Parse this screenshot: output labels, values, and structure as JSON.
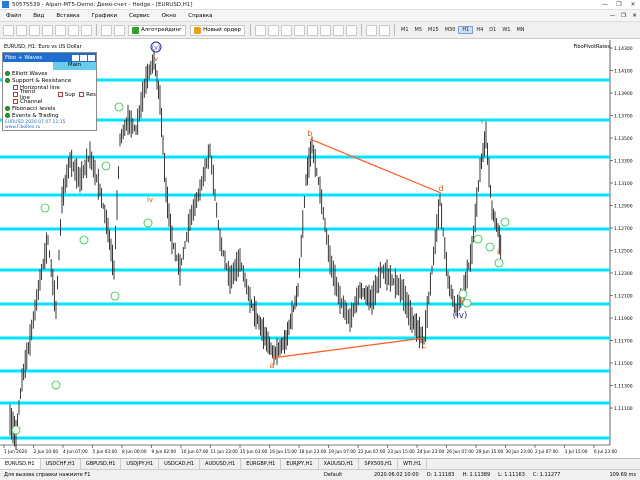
{
  "window": {
    "title": "50575539 - Alpari-MT5-Demo: Демо-счет - Hedge - [EURUSD,H1]",
    "controls": [
      "—",
      "❐",
      "✕"
    ]
  },
  "menu": {
    "items": [
      "Файл",
      "Вид",
      "Вставка",
      "Графики",
      "Сервис",
      "Окно",
      "Справка"
    ]
  },
  "toolbar": {
    "algo_label": "Алготрейдинг",
    "new_order_label": "Новый ордер",
    "timeframes": [
      "M1",
      "M5",
      "M15",
      "M30",
      "H1",
      "H4",
      "D1",
      "W1",
      "MN"
    ],
    "active_timeframe": "H1"
  },
  "chart": {
    "title": "EURUSD, H1: Euro vs US Dollar",
    "corner_label": "FiboPivotRates",
    "price_labels": [
      "1.14300",
      "1.14100",
      "1.13900",
      "1.13700",
      "1.13500",
      "1.13300",
      "1.13100",
      "1.12900",
      "1.12700",
      "1.12500",
      "1.12300",
      "1.12100",
      "1.11900",
      "1.11700",
      "1.11500",
      "1.11300",
      "1.11100"
    ],
    "date_labels": [
      "1 Jun 2020",
      "2 Jun 10:00",
      "4 Jun 07:00",
      "5 Jun 03:00",
      "8 Jun 00:00",
      "9 Jun 02:00",
      "10 Jun 07:00",
      "11 Jun 23:00",
      "15 Jun 03:00",
      "16 Jun 15:00",
      "18 Jun 23:00",
      "19 Jun 07:00",
      "22 Jun 07:00",
      "23 Jun 15:00",
      "24 Jun 23:00",
      "26 Jun 07:00",
      "29 Jun 15:00",
      "30 Jun 23:00",
      "2 Jul 07:00",
      "3 Jul 15:00",
      "6 Jul 23:00"
    ],
    "wave_labels": {
      "v_top": "v",
      "iv_mid": "iv",
      "iv_blue": "(iv)",
      "v_circle": "(v)",
      "a": "a",
      "b": "b",
      "c": "c",
      "d": "d",
      "e": "e",
      "ii": "ii",
      "i": "i"
    },
    "colors": {
      "level_line": "#00e5ff",
      "wave_line": "#ff5a1f",
      "candle": "#222222",
      "label_orange": "#e05a10",
      "label_green": "#2bbf4a",
      "label_blue": "#2a2aa0"
    }
  },
  "panel": {
    "title": "Fibo + Waves",
    "tab_left": "",
    "tab_right": "Main",
    "rows": [
      {
        "type": "dot",
        "label": "Elliott Waves"
      },
      {
        "type": "dot",
        "label": "Support & Resistance"
      },
      {
        "type": "box",
        "label": "Horizontal line"
      },
      {
        "type": "box",
        "label": "Trend line",
        "extra_a": "Sup",
        "extra_b": "Res"
      },
      {
        "type": "box",
        "label": "Channel"
      },
      {
        "type": "dot",
        "label": "Fibonacci levels"
      },
      {
        "type": "dot",
        "label": "Events & Trading"
      }
    ],
    "footer": "EURUSD  2020.07.07 12:15    www.FiboRes.ru"
  },
  "bottom_tabs": [
    "EURUSD,H1",
    "USDCHF,H1",
    "GBPUSD,H1",
    "USDJPY,H1",
    "USDCAD,H1",
    "AUDUSD,H1",
    "EURGBP,H1",
    "EURJPY,H1",
    "XAUUSD,H1",
    "SPX500,H1",
    "WTI,H1"
  ],
  "status": {
    "help": "Для вызова справки нажмите F1",
    "profile": "Default",
    "datetime": "2020.06.02 10:00",
    "o": "O: 1.11183",
    "h": "H: 1.11389",
    "l": "L: 1.11163",
    "c": "C: 1.11277",
    "traffic": "109.69 ms"
  }
}
